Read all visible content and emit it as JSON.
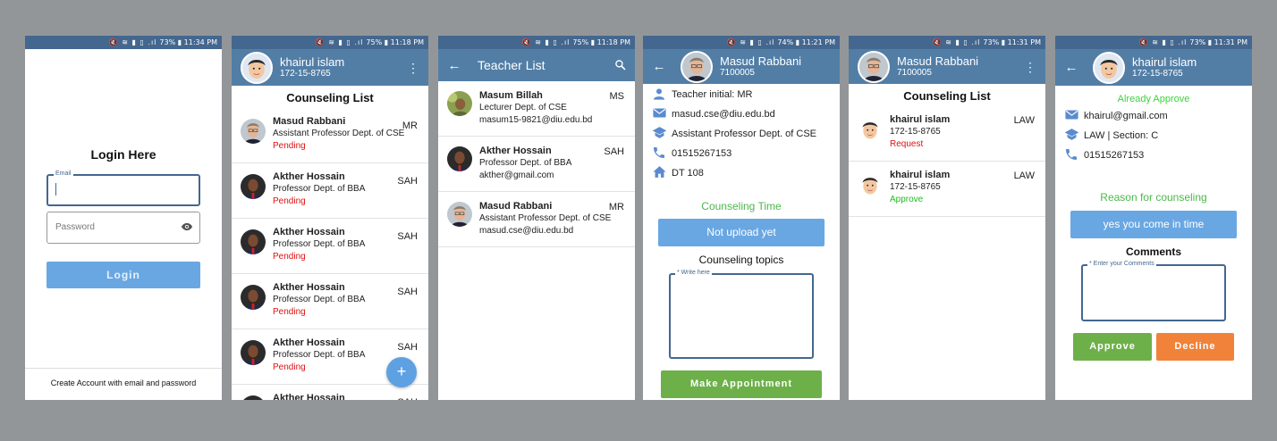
{
  "screen1": {
    "status": "73% ▮ 11:34 PM",
    "title": "Login Here",
    "email_label": "Email",
    "password_placeholder": "Password",
    "login_label": "Login",
    "footer_link": "Create Account with email and password"
  },
  "screen2": {
    "status": "75% ▮ 11:18 PM",
    "user_name": "khairul islam",
    "user_id": "172-15-8765",
    "heading": "Counseling List",
    "items": [
      {
        "name": "Masud Rabbani",
        "code": "MR",
        "role": "Assistant Professor Dept. of CSE",
        "status": "Pending"
      },
      {
        "name": "Akther Hossain",
        "code": "SAH",
        "role": "Professor Dept. of BBA",
        "status": "Pending"
      },
      {
        "name": "Akther Hossain",
        "code": "SAH",
        "role": "Professor Dept. of BBA",
        "status": "Pending"
      },
      {
        "name": "Akther Hossain",
        "code": "SAH",
        "role": "Professor Dept. of BBA",
        "status": "Pending"
      },
      {
        "name": "Akther Hossain",
        "code": "SAH",
        "role": "Professor Dept. of BBA",
        "status": "Pending"
      },
      {
        "name": "Akther Hossain",
        "code": "SAH",
        "role": "",
        "status": ""
      }
    ],
    "fab": "+"
  },
  "screen3": {
    "status": "75% ▮ 11:18 PM",
    "title": "Teacher List",
    "items": [
      {
        "name": "Masum Billah",
        "code": "MS",
        "role": "Lecturer Dept. of CSE",
        "email": "masum15-9821@diu.edu.bd"
      },
      {
        "name": "Akther Hossain",
        "code": "SAH",
        "role": "Professor Dept. of BBA",
        "email": "akther@gmail.com"
      },
      {
        "name": "Masud Rabbani",
        "code": "MR",
        "role": "Assistant Professor Dept. of CSE",
        "email": "masud.cse@diu.edu.bd"
      }
    ]
  },
  "screen4": {
    "status": "74% ▮ 11:21 PM",
    "name": "Masud Rabbani",
    "id": "7100005",
    "rows": [
      {
        "icon": "person-icon",
        "text": "Teacher initial: MR"
      },
      {
        "icon": "mail-icon",
        "text": "masud.cse@diu.edu.bd"
      },
      {
        "icon": "school-icon",
        "text": "Assistant Professor Dept. of CSE"
      },
      {
        "icon": "phone-icon",
        "text": "01515267153"
      },
      {
        "icon": "home-icon",
        "text": "DT 108"
      }
    ],
    "time_title": "Counseling Time",
    "time_button": "Not upload yet",
    "topics_title": "Counseling topics",
    "topics_label": "* Write here",
    "make_button": "Make Appointment"
  },
  "screen5": {
    "status": "73% ▮ 11:31 PM",
    "name": "Masud Rabbani",
    "id": "7100005",
    "heading": "Counseling List",
    "items": [
      {
        "name": "khairul islam",
        "code": "LAW",
        "id": "172-15-8765",
        "status": "Request"
      },
      {
        "name": "khairul islam",
        "code": "LAW",
        "id": "172-15-8765",
        "status": "Approve"
      }
    ]
  },
  "screen6": {
    "status": "73% ▮ 11:31 PM",
    "name": "khairul islam",
    "id": "172-15-8765",
    "state": "Already Approve",
    "rows": [
      {
        "icon": "mail-icon",
        "text": "khairul@gmail.com"
      },
      {
        "icon": "school-icon",
        "text": "LAW | Section: C"
      },
      {
        "icon": "phone-icon",
        "text": "01515267153"
      }
    ],
    "reason_title": "Reason for counseling",
    "reason_value": "yes you come in time",
    "comments_title": "Comments",
    "comments_label": "* Enter your Comments",
    "approve_button": "Approve",
    "decline_button": "Decline"
  },
  "colors": {
    "appbar": "#527ea6",
    "statusbar": "#44678f",
    "button_blue": "#69a7e3",
    "green": "#6db04a",
    "orange": "#f0823a",
    "pending": "#e01010",
    "approve": "#22bb22"
  }
}
